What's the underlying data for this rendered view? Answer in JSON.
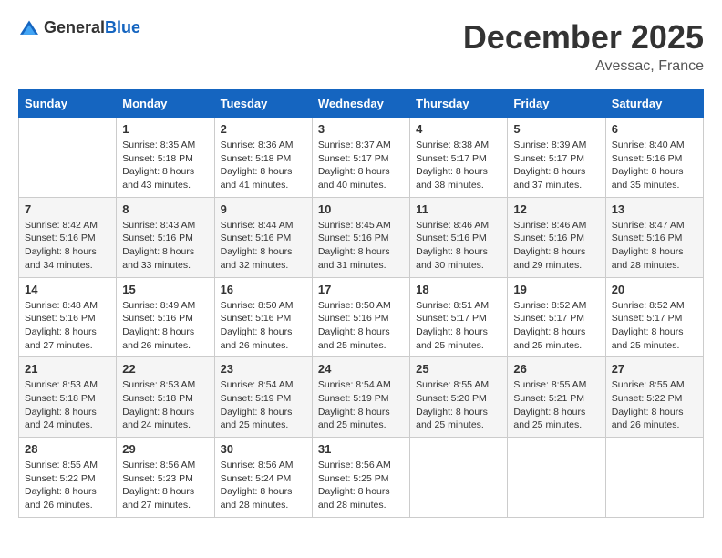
{
  "header": {
    "logo_general": "General",
    "logo_blue": "Blue",
    "month_year": "December 2025",
    "location": "Avessac, France"
  },
  "columns": [
    "Sunday",
    "Monday",
    "Tuesday",
    "Wednesday",
    "Thursday",
    "Friday",
    "Saturday"
  ],
  "weeks": [
    [
      {
        "day": "",
        "info": ""
      },
      {
        "day": "1",
        "info": "Sunrise: 8:35 AM\nSunset: 5:18 PM\nDaylight: 8 hours\nand 43 minutes."
      },
      {
        "day": "2",
        "info": "Sunrise: 8:36 AM\nSunset: 5:18 PM\nDaylight: 8 hours\nand 41 minutes."
      },
      {
        "day": "3",
        "info": "Sunrise: 8:37 AM\nSunset: 5:17 PM\nDaylight: 8 hours\nand 40 minutes."
      },
      {
        "day": "4",
        "info": "Sunrise: 8:38 AM\nSunset: 5:17 PM\nDaylight: 8 hours\nand 38 minutes."
      },
      {
        "day": "5",
        "info": "Sunrise: 8:39 AM\nSunset: 5:17 PM\nDaylight: 8 hours\nand 37 minutes."
      },
      {
        "day": "6",
        "info": "Sunrise: 8:40 AM\nSunset: 5:16 PM\nDaylight: 8 hours\nand 35 minutes."
      }
    ],
    [
      {
        "day": "7",
        "info": "Sunrise: 8:42 AM\nSunset: 5:16 PM\nDaylight: 8 hours\nand 34 minutes."
      },
      {
        "day": "8",
        "info": "Sunrise: 8:43 AM\nSunset: 5:16 PM\nDaylight: 8 hours\nand 33 minutes."
      },
      {
        "day": "9",
        "info": "Sunrise: 8:44 AM\nSunset: 5:16 PM\nDaylight: 8 hours\nand 32 minutes."
      },
      {
        "day": "10",
        "info": "Sunrise: 8:45 AM\nSunset: 5:16 PM\nDaylight: 8 hours\nand 31 minutes."
      },
      {
        "day": "11",
        "info": "Sunrise: 8:46 AM\nSunset: 5:16 PM\nDaylight: 8 hours\nand 30 minutes."
      },
      {
        "day": "12",
        "info": "Sunrise: 8:46 AM\nSunset: 5:16 PM\nDaylight: 8 hours\nand 29 minutes."
      },
      {
        "day": "13",
        "info": "Sunrise: 8:47 AM\nSunset: 5:16 PM\nDaylight: 8 hours\nand 28 minutes."
      }
    ],
    [
      {
        "day": "14",
        "info": "Sunrise: 8:48 AM\nSunset: 5:16 PM\nDaylight: 8 hours\nand 27 minutes."
      },
      {
        "day": "15",
        "info": "Sunrise: 8:49 AM\nSunset: 5:16 PM\nDaylight: 8 hours\nand 26 minutes."
      },
      {
        "day": "16",
        "info": "Sunrise: 8:50 AM\nSunset: 5:16 PM\nDaylight: 8 hours\nand 26 minutes."
      },
      {
        "day": "17",
        "info": "Sunrise: 8:50 AM\nSunset: 5:16 PM\nDaylight: 8 hours\nand 25 minutes."
      },
      {
        "day": "18",
        "info": "Sunrise: 8:51 AM\nSunset: 5:17 PM\nDaylight: 8 hours\nand 25 minutes."
      },
      {
        "day": "19",
        "info": "Sunrise: 8:52 AM\nSunset: 5:17 PM\nDaylight: 8 hours\nand 25 minutes."
      },
      {
        "day": "20",
        "info": "Sunrise: 8:52 AM\nSunset: 5:17 PM\nDaylight: 8 hours\nand 25 minutes."
      }
    ],
    [
      {
        "day": "21",
        "info": "Sunrise: 8:53 AM\nSunset: 5:18 PM\nDaylight: 8 hours\nand 24 minutes."
      },
      {
        "day": "22",
        "info": "Sunrise: 8:53 AM\nSunset: 5:18 PM\nDaylight: 8 hours\nand 24 minutes."
      },
      {
        "day": "23",
        "info": "Sunrise: 8:54 AM\nSunset: 5:19 PM\nDaylight: 8 hours\nand 25 minutes."
      },
      {
        "day": "24",
        "info": "Sunrise: 8:54 AM\nSunset: 5:19 PM\nDaylight: 8 hours\nand 25 minutes."
      },
      {
        "day": "25",
        "info": "Sunrise: 8:55 AM\nSunset: 5:20 PM\nDaylight: 8 hours\nand 25 minutes."
      },
      {
        "day": "26",
        "info": "Sunrise: 8:55 AM\nSunset: 5:21 PM\nDaylight: 8 hours\nand 25 minutes."
      },
      {
        "day": "27",
        "info": "Sunrise: 8:55 AM\nSunset: 5:22 PM\nDaylight: 8 hours\nand 26 minutes."
      }
    ],
    [
      {
        "day": "28",
        "info": "Sunrise: 8:55 AM\nSunset: 5:22 PM\nDaylight: 8 hours\nand 26 minutes."
      },
      {
        "day": "29",
        "info": "Sunrise: 8:56 AM\nSunset: 5:23 PM\nDaylight: 8 hours\nand 27 minutes."
      },
      {
        "day": "30",
        "info": "Sunrise: 8:56 AM\nSunset: 5:24 PM\nDaylight: 8 hours\nand 28 minutes."
      },
      {
        "day": "31",
        "info": "Sunrise: 8:56 AM\nSunset: 5:25 PM\nDaylight: 8 hours\nand 28 minutes."
      },
      {
        "day": "",
        "info": ""
      },
      {
        "day": "",
        "info": ""
      },
      {
        "day": "",
        "info": ""
      }
    ]
  ]
}
